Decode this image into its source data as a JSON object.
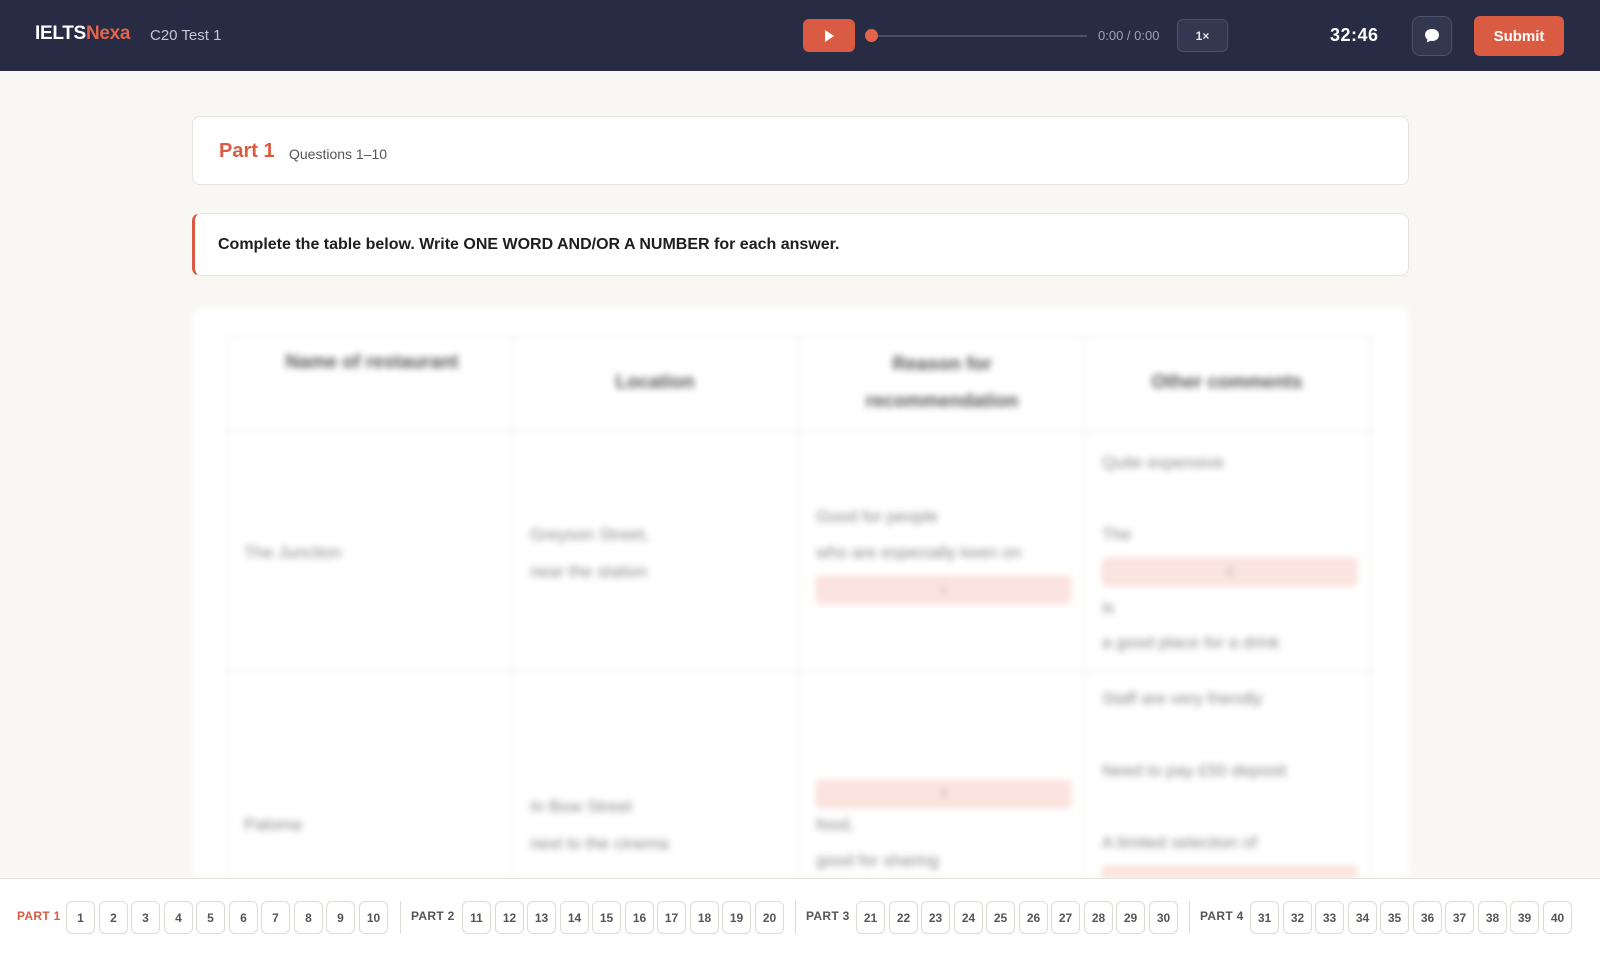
{
  "header": {
    "brand_main": "IELTS",
    "brand_accent": "Nexa",
    "test_name": "C20 Test 1",
    "time_readout": "0:00 / 0:00",
    "speed": "1×",
    "timer": "32:46",
    "submit_label": "Submit",
    "audio_progress": 0
  },
  "part": {
    "title": "Part 1",
    "subtitle": "Questions 1–10"
  },
  "instruction": "Complete the table below. Write ONE WORD AND/OR A NUMBER for each answer.",
  "table": {
    "headers": [
      "Name of restaurant",
      "Location",
      "Reason for recommendation",
      "Other comments"
    ],
    "rows": [
      {
        "name": "The Junction",
        "location": [
          "Greyson Street,",
          "near the station"
        ],
        "reason": [
          "Good for people",
          "who are especially keen on"
        ],
        "reason_gap": "1",
        "comments": [
          "Quite expensive",
          "The",
          "is",
          "a good place for a drink"
        ],
        "comments_gap": "2"
      },
      {
        "name": "Paloma",
        "location": [
          "In Bow Street",
          "next to the cinema"
        ],
        "reason_gap": "3",
        "reason": [
          "food,",
          "good for sharing"
        ],
        "comments": [
          "Staff are very friendly",
          "Need to pay £50 deposit",
          "A limited selection of"
        ]
      }
    ]
  },
  "nav": {
    "parts": [
      {
        "label": "PART 1",
        "questions": [
          "1",
          "2",
          "3",
          "4",
          "5",
          "6",
          "7",
          "8",
          "9",
          "10"
        ]
      },
      {
        "label": "PART 2",
        "questions": [
          "11",
          "12",
          "13",
          "14",
          "15",
          "16",
          "17",
          "18",
          "19",
          "20"
        ]
      },
      {
        "label": "PART 3",
        "questions": [
          "21",
          "22",
          "23",
          "24",
          "25",
          "26",
          "27",
          "28",
          "29",
          "30"
        ]
      },
      {
        "label": "PART 4",
        "questions": [
          "31",
          "32",
          "33",
          "34",
          "35",
          "36",
          "37",
          "38",
          "39",
          "40"
        ]
      }
    ],
    "active_part": "PART 1"
  },
  "colors": {
    "header_bg": "#272b43",
    "accent": "#d95b42",
    "page_bg": "#f8f7f3"
  }
}
